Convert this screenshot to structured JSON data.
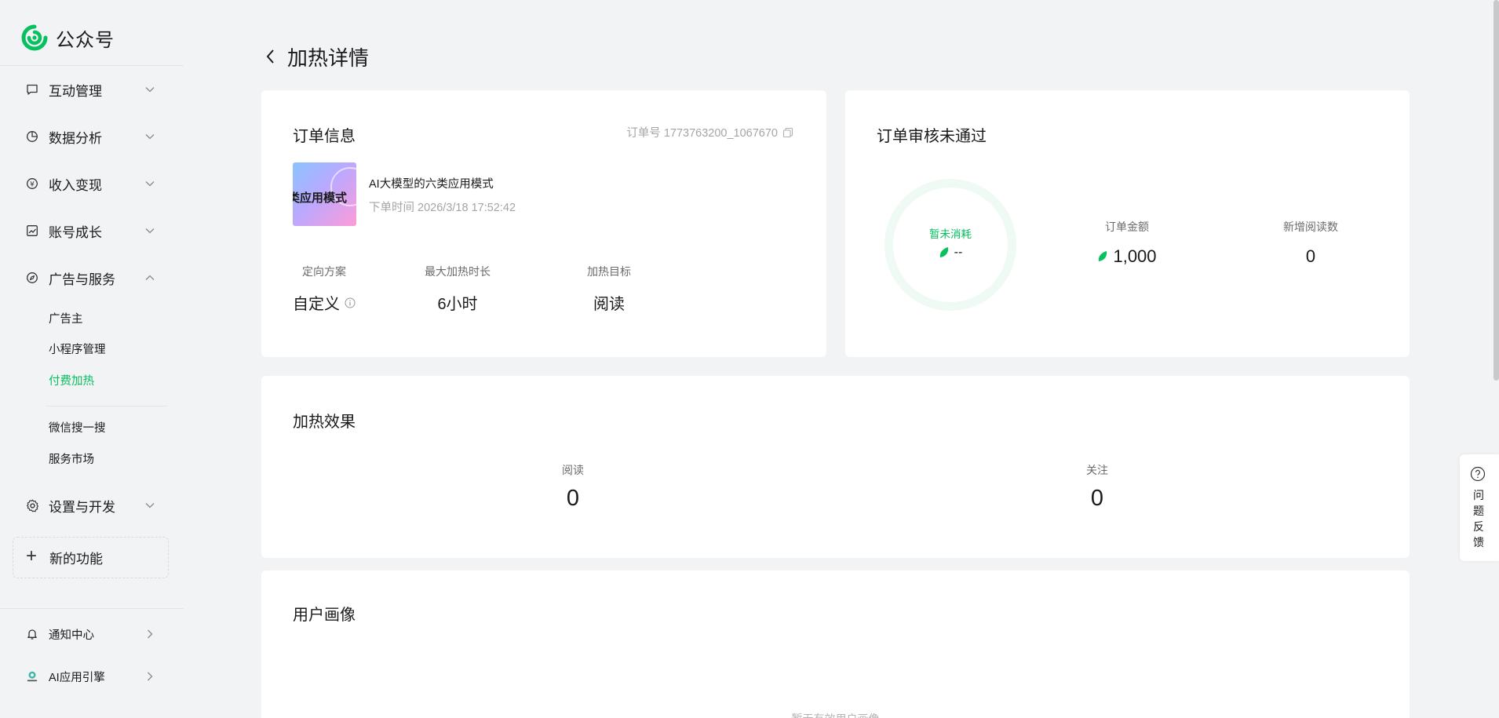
{
  "brand": {
    "name": "公众号"
  },
  "sidebar": {
    "items": [
      {
        "label": "互动管理",
        "icon": "message-icon"
      },
      {
        "label": "数据分析",
        "icon": "pie-chart-icon"
      },
      {
        "label": "收入变现",
        "icon": "yuan-icon"
      },
      {
        "label": "账号成长",
        "icon": "growth-icon"
      },
      {
        "label": "广告与服务",
        "icon": "compass-icon"
      }
    ],
    "ad_sub": [
      "广告主",
      "小程序管理",
      "付费加热"
    ],
    "ad_sub2": [
      "微信搜一搜",
      "服务市场"
    ],
    "settings": "设置与开发",
    "new_feature": "新的功能",
    "notification": "通知中心",
    "ai_engine": "AI应用引擎"
  },
  "page": {
    "title": "加热详情"
  },
  "order": {
    "title": "订单信息",
    "order_no": "订单号 1773763200_1067670",
    "thumb_text": "类应用模式",
    "article_title": "AI大模型的六类应用模式",
    "order_time": "下单时间 2026/3/18 17:52:42",
    "stats": [
      {
        "label": "定向方案",
        "value": "自定义"
      },
      {
        "label": "最大加热时长",
        "value": "6小时"
      },
      {
        "label": "加热目标",
        "value": "阅读"
      }
    ]
  },
  "review": {
    "title": "订单审核未通过",
    "ring_label": "暂未消耗",
    "ring_value": "--",
    "amount_label": "订单金额",
    "amount_value": "1,000",
    "reads_label": "新增阅读数",
    "reads_value": "0"
  },
  "effect": {
    "title": "加热效果",
    "read_label": "阅读",
    "read_value": "0",
    "follow_label": "关注",
    "follow_value": "0"
  },
  "portrait": {
    "title": "用户画像",
    "empty_text": "暂无有效用户画像"
  },
  "feedback": {
    "label": "问题反馈"
  },
  "colors": {
    "accent": "#07c160",
    "page_bg": "#f2f3f5",
    "card_bg": "#ffffff"
  }
}
